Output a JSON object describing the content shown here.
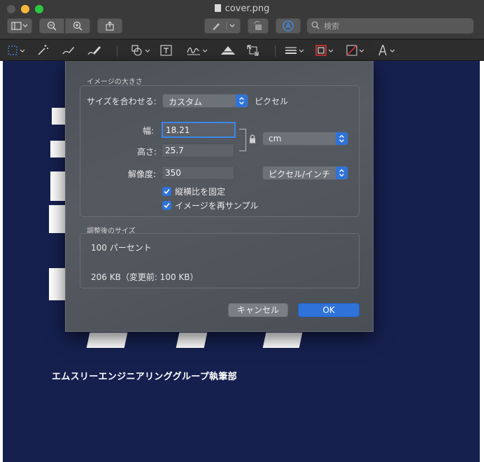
{
  "window": {
    "title": "cover.png",
    "search_placeholder": "検索"
  },
  "cover": {
    "text": "エムスリーエンジニアリンググループ執筆部"
  },
  "dialog": {
    "section_size": "イメージの大きさ",
    "fit_label": "サイズを合わせる:",
    "fit_value": "カスタム",
    "fit_unit": "ピクセル",
    "width_label": "幅:",
    "width_value": "18.21",
    "height_label": "高さ:",
    "height_value": "25.7",
    "unit_value": "cm",
    "resolution_label": "解像度:",
    "resolution_value": "350",
    "resolution_unit": "ピクセル/インチ",
    "checkbox_proportional": "縦横比を固定",
    "checkbox_resample": "イメージを再サンプル",
    "section_result": "調整後のサイズ",
    "result_percent": "100 パーセント",
    "result_size": "206 KB（変更前: 100 KB）",
    "cancel_label": "キャンセル",
    "ok_label": "OK"
  },
  "colors": {
    "accent": "#2f73d9",
    "cover_bg": "#16204f"
  }
}
